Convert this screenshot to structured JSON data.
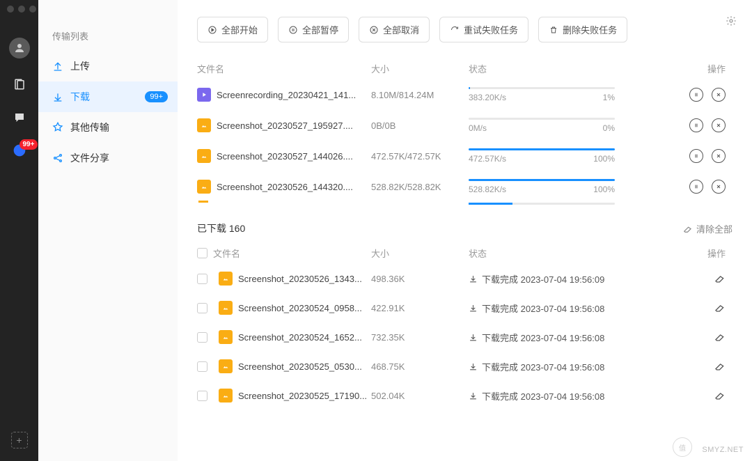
{
  "rail": {
    "badge": "99+"
  },
  "sidebar": {
    "title": "传输列表",
    "items": [
      {
        "label": "上传"
      },
      {
        "label": "下载",
        "badge": "99+"
      },
      {
        "label": "其他传输"
      },
      {
        "label": "文件分享"
      }
    ]
  },
  "toolbar": {
    "start_all": "全部开始",
    "pause_all": "全部暂停",
    "cancel_all": "全部取消",
    "retry_failed": "重试失败任务",
    "delete_failed": "删除失败任务"
  },
  "active_headers": {
    "name": "文件名",
    "size": "大小",
    "status": "状态",
    "ops": "操作"
  },
  "active_rows": [
    {
      "icon": "video",
      "name": "Screenrecording_20230421_141...",
      "size": "8.10M/814.24M",
      "speed": "383.20K/s",
      "pct": "1%",
      "pctv": 1
    },
    {
      "icon": "img",
      "name": "Screenshot_20230527_195927....",
      "size": "0B/0B",
      "speed": "0M/s",
      "pct": "0%",
      "pctv": 0
    },
    {
      "icon": "img",
      "name": "Screenshot_20230527_144026....",
      "size": "472.57K/472.57K",
      "speed": "472.57K/s",
      "pct": "100%",
      "pctv": 100
    },
    {
      "icon": "img",
      "name": "Screenshot_20230526_144320....",
      "size": "528.82K/528.82K",
      "speed": "528.82K/s",
      "pct": "100%",
      "pctv": 100
    }
  ],
  "done_section": {
    "title": "已下载 160",
    "clear_all": "清除全部"
  },
  "done_headers": {
    "name": "文件名",
    "size": "大小",
    "status": "状态",
    "ops": "操作"
  },
  "done_rows": [
    {
      "name": "Screenshot_20230526_1343...",
      "size": "498.36K",
      "status": "下载完成 2023-07-04 19:56:09"
    },
    {
      "name": "Screenshot_20230524_0958...",
      "size": "422.91K",
      "status": "下载完成 2023-07-04 19:56:08"
    },
    {
      "name": "Screenshot_20230524_1652...",
      "size": "732.35K",
      "status": "下载完成 2023-07-04 19:56:08"
    },
    {
      "name": "Screenshot_20230525_0530...",
      "size": "468.75K",
      "status": "下载完成 2023-07-04 19:56:08"
    },
    {
      "name": "Screenshot_20230525_17190...",
      "size": "502.04K",
      "status": "下载完成 2023-07-04 19:56:08"
    }
  ],
  "watermark": "SMYZ.NET"
}
